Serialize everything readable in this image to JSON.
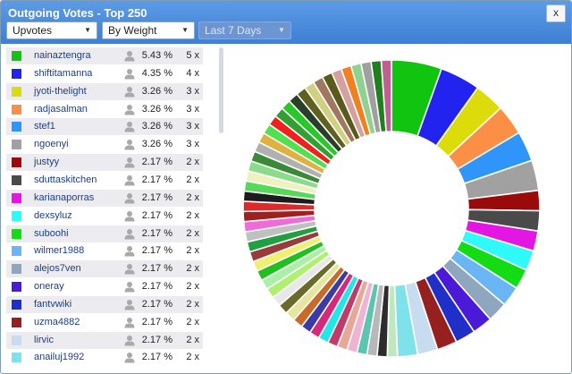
{
  "window": {
    "title": "Outgoing Votes - Top 250",
    "close_label": "x"
  },
  "toolbar": {
    "vote_type": "Upvotes",
    "sort_by": "By Weight",
    "period": "Last 7 Days"
  },
  "list": [
    {
      "name": "nainaztengra",
      "pct": "5.43 %",
      "count": "5 x",
      "color": "#10c410"
    },
    {
      "name": "shiftitamanna",
      "pct": "4.35 %",
      "count": "4 x",
      "color": "#2323f0"
    },
    {
      "name": "jyoti-thelight",
      "pct": "3.26 %",
      "count": "3 x",
      "color": "#dcdc0a"
    },
    {
      "name": "radjasalman",
      "pct": "3.26 %",
      "count": "3 x",
      "color": "#fb8f46"
    },
    {
      "name": "stef1",
      "pct": "3.26 %",
      "count": "3 x",
      "color": "#2f95fb"
    },
    {
      "name": "ngoenyi",
      "pct": "3.26 %",
      "count": "3 x",
      "color": "#a1a1a1"
    },
    {
      "name": "justyy",
      "pct": "2.17 %",
      "count": "2 x",
      "color": "#9a0a0a"
    },
    {
      "name": "sduttaskitchen",
      "pct": "2.17 %",
      "count": "2 x",
      "color": "#4a4a4a"
    },
    {
      "name": "karianaporras",
      "pct": "2.17 %",
      "count": "2 x",
      "color": "#e416e4"
    },
    {
      "name": "dexsyluz",
      "pct": "2.17 %",
      "count": "2 x",
      "color": "#2efafa"
    },
    {
      "name": "suboohi",
      "pct": "2.17 %",
      "count": "2 x",
      "color": "#14dc14"
    },
    {
      "name": "wilmer1988",
      "pct": "2.17 %",
      "count": "2 x",
      "color": "#6ab6f5"
    },
    {
      "name": "alejos7ven",
      "pct": "2.17 %",
      "count": "2 x",
      "color": "#8ea6be"
    },
    {
      "name": "oneray",
      "pct": "2.17 %",
      "count": "2 x",
      "color": "#4a1ad8"
    },
    {
      "name": "fantvwiki",
      "pct": "2.17 %",
      "count": "2 x",
      "color": "#1f2fc8"
    },
    {
      "name": "uzma4882",
      "pct": "2.17 %",
      "count": "2 x",
      "color": "#962020"
    },
    {
      "name": "lirvic",
      "pct": "2.17 %",
      "count": "2 x",
      "color": "#c8dcf0"
    },
    {
      "name": "anailuj1992",
      "pct": "2.17 %",
      "count": "2 x",
      "color": "#7ee2ea"
    }
  ],
  "chart_data": {
    "type": "pie",
    "title": "",
    "series": [
      {
        "name": "nainaztengra",
        "value": 5.43
      },
      {
        "name": "shiftitamanna",
        "value": 4.35
      },
      {
        "name": "jyoti-thelight",
        "value": 3.26
      },
      {
        "name": "radjasalman",
        "value": 3.26
      },
      {
        "name": "stef1",
        "value": 3.26
      },
      {
        "name": "ngoenyi",
        "value": 3.26
      },
      {
        "name": "justyy",
        "value": 2.17
      },
      {
        "name": "sduttaskitchen",
        "value": 2.17
      },
      {
        "name": "karianaporras",
        "value": 2.17
      },
      {
        "name": "dexsyluz",
        "value": 2.17
      },
      {
        "name": "suboohi",
        "value": 2.17
      },
      {
        "name": "wilmer1988",
        "value": 2.17
      },
      {
        "name": "alejos7ven",
        "value": 2.17
      },
      {
        "name": "oneray",
        "value": 2.17
      },
      {
        "name": "fantvwiki",
        "value": 2.17
      },
      {
        "name": "uzma4882",
        "value": 2.17
      },
      {
        "name": "lirvic",
        "value": 2.17
      },
      {
        "name": "anailuj1992",
        "value": 2.17
      }
    ],
    "other_slices": [
      1.09,
      1.09,
      1.09,
      1.09,
      1.09,
      1.09,
      1.09,
      1.09,
      1.09,
      1.09,
      1.09,
      1.09,
      1.09,
      1.09,
      1.09,
      1.09,
      1.09,
      1.09,
      1.09,
      1.09,
      1.09,
      1.09,
      1.09,
      1.09,
      1.09,
      1.09,
      1.09,
      1.09,
      1.09,
      1.09,
      1.09,
      1.09,
      1.09,
      1.09,
      1.09,
      1.09,
      1.09,
      1.09,
      1.09,
      1.09,
      1.09,
      1.09,
      1.09,
      1.09,
      1.09,
      1.09
    ],
    "other_colors": [
      "#bfe8bf",
      "#2c2c2c",
      "#b8b8b8",
      "#5bc6b0",
      "#f0b4d2",
      "#e8a898",
      "#c23a6a",
      "#20e8e8",
      "#d8287c",
      "#3a3aa8",
      "#c86a2a",
      "#e6e6a0",
      "#6a6a2a",
      "#e8e8e8",
      "#b0f070",
      "#aaf0aa",
      "#20c020",
      "#f0f070",
      "#9a3a3a",
      "#20a040",
      "#c0c0c0",
      "#f06ad8",
      "#a02020",
      "#dc2a2a",
      "#1c1c1c",
      "#58d858",
      "#f0f0c0",
      "#8adc8a",
      "#3a8a3a",
      "#b0b0b0",
      "#e0b040",
      "#50e050",
      "#f02020",
      "#30a030",
      "#28c828",
      "#284028",
      "#606020",
      "#d0d080",
      "#a07860",
      "#5a5a1a",
      "#d4a0a0",
      "#f08020",
      "#90d090",
      "#a0a0a0",
      "#208020",
      "#c06090"
    ]
  }
}
